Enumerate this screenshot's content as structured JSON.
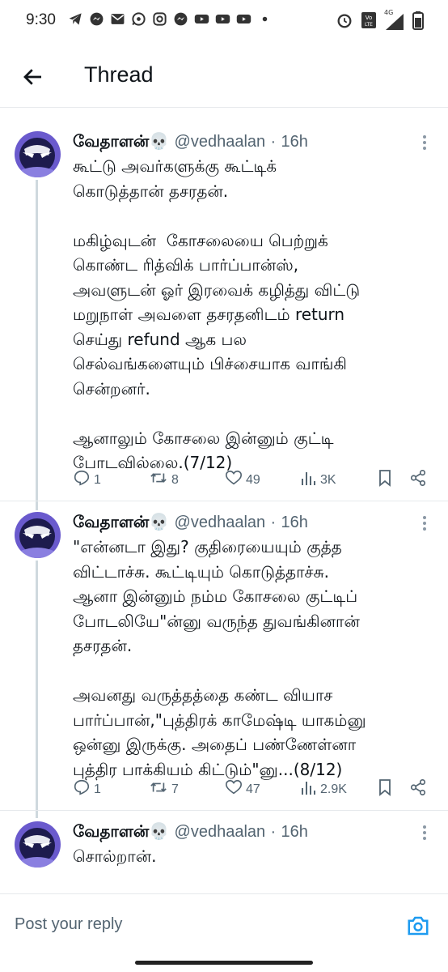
{
  "status_bar": {
    "time": "9:30",
    "network": "4G"
  },
  "header": {
    "title": "Thread"
  },
  "colors": {
    "accent": "#1d9bf0",
    "secondary_text": "#536471",
    "thread_line": "#cfd9de"
  },
  "tweets": [
    {
      "name": "வேதாளன்💀",
      "handle": "@vedhaalan",
      "sep": "·",
      "time": "16h",
      "text": "கூட்டு அவர்களுக்கு கூட்டிக்\nகொடுத்தான் தசரதன்.\n\nமகிழ்வுடன்  கோசலையை பெற்றுக்\nகொண்ட ரித்விக் பார்ப்பான்ஸ்,\nஅவளுடன் ஓர் இரவைக் கழித்து விட்டு\nமறுநாள் அவளை தசரதனிடம் return\nசெய்து refund ஆக பல\nசெல்வங்களையும் பிச்சையாக வாங்கி\nசென்றனர்.\n\nஆனாலும் கோசலை இன்னும் குட்டி\nபோடவில்லை.(7/12)",
      "replies": "1",
      "retweets": "8",
      "likes": "49",
      "views": "3K"
    },
    {
      "name": "வேதாளன்💀",
      "handle": "@vedhaalan",
      "sep": "·",
      "time": "16h",
      "text": "\"என்னடா இது? குதிரையையும் குத்த\nவிட்டாச்சு. கூட்டியும் கொடுத்தாச்சு.\nஆனா இன்னும் நம்ம கோசலை குட்டிப்\nபோடலியே\"ன்னு வருந்த துவங்கினான்\nதசரதன்.\n\nஅவனது வருத்தத்தை கண்ட வியாச\nபார்ப்பான்,\"புத்திரக் காமேஷ்டி யாகம்னு\nஒன்னு இருக்கு. அதைப் பண்ணேள்னா\nபுத்திர பாக்கியம் கிட்டும்\"னு...(8/12)",
      "replies": "1",
      "retweets": "7",
      "likes": "47",
      "views": "2.9K"
    },
    {
      "name": "வேதாளன்💀",
      "handle": "@vedhaalan",
      "sep": "·",
      "time": "16h",
      "text": "சொல்றான்."
    }
  ],
  "reply_bar": {
    "placeholder": "Post your reply"
  },
  "icons": {
    "back": "arrow-left-icon",
    "more": "more-vertical-icon",
    "reply": "comment-icon",
    "retweet": "retweet-icon",
    "like": "heart-icon",
    "views": "bar-chart-icon",
    "bookmark": "bookmark-icon",
    "share": "share-icon",
    "camera": "camera-icon"
  }
}
